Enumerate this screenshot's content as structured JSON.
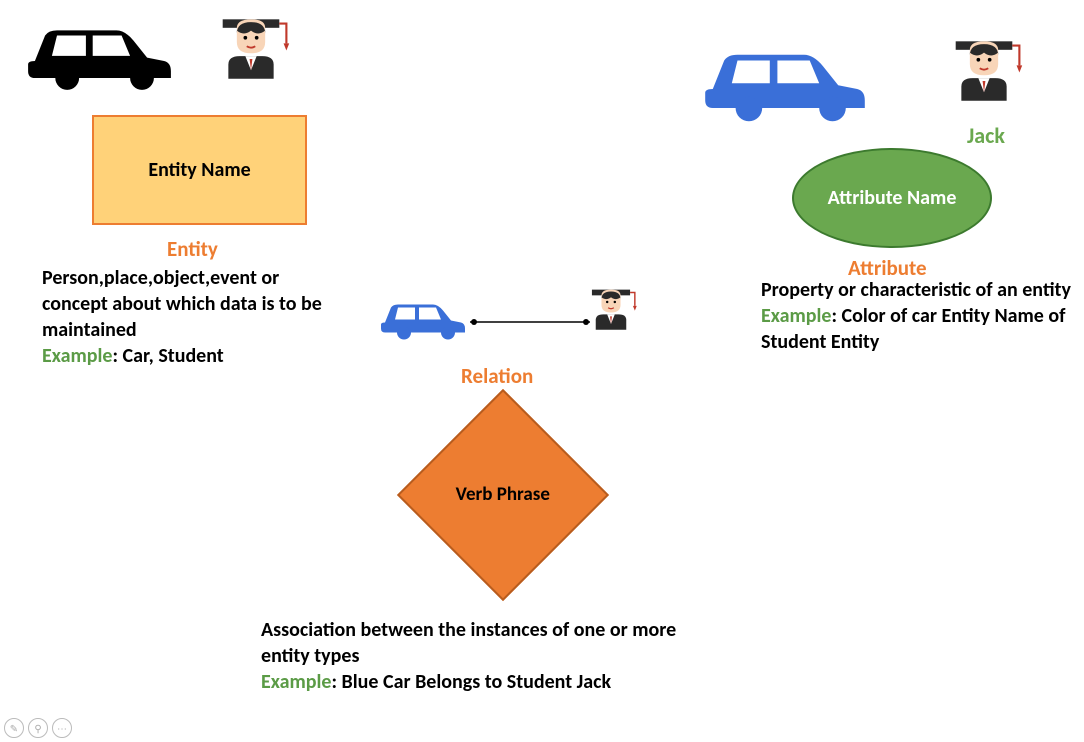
{
  "entity": {
    "shapeLabel": "Entity Name",
    "heading": "Entity",
    "description": "Person,place,object,event or concept about which data is to be maintained",
    "exampleLabel": "Example",
    "exampleText": ": Car, Student"
  },
  "attribute": {
    "studentName": "Jack",
    "shapeLabel": "Attribute Name",
    "heading": "Attribute",
    "description": "Property or characteristic of an entity",
    "exampleLabel": "Example",
    "exampleText": ": Color of car Entity Name of Student Entity"
  },
  "relation": {
    "heading": "Relation",
    "shapeLabel": "Verb Phrase",
    "description": "Association between the instances of one or more entity types",
    "exampleLabel": "Example",
    "exampleText": ": Blue Car Belongs to Student Jack"
  }
}
